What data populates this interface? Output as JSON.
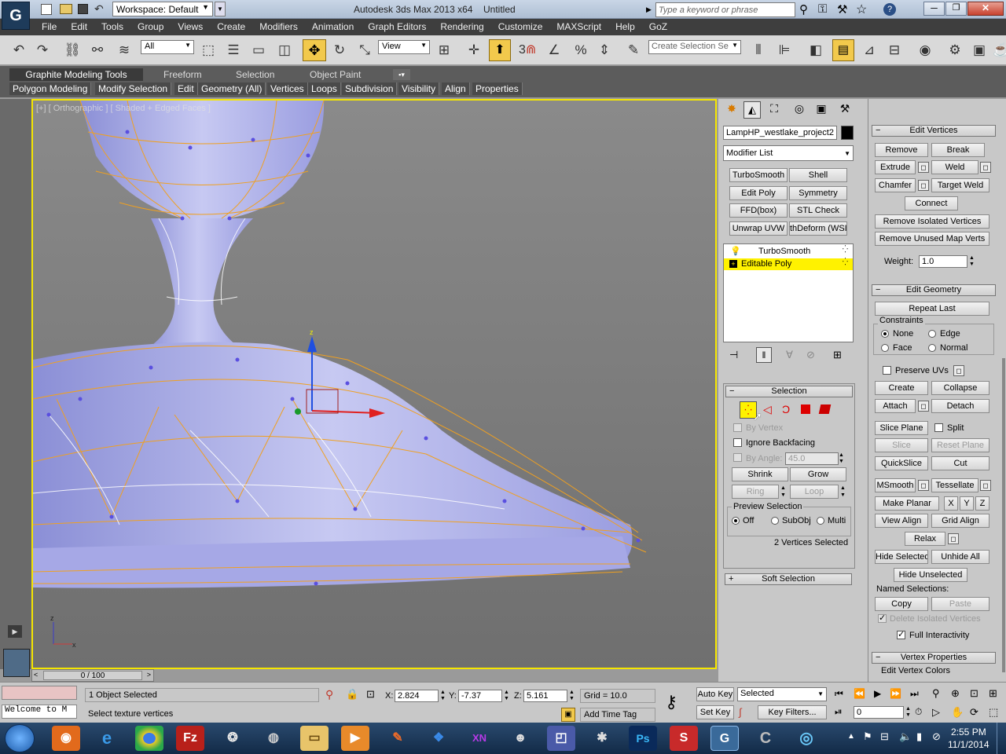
{
  "title_bar": {
    "workspace": "Workspace: Default",
    "app_title": "Autodesk 3ds Max  2013 x64",
    "doc_title": "Untitled",
    "search_placeholder": "Type a keyword or phrase"
  },
  "menu": [
    "File",
    "Edit",
    "Tools",
    "Group",
    "Views",
    "Create",
    "Modifiers",
    "Animation",
    "Graph Editors",
    "Rendering",
    "Customize",
    "MAXScript",
    "Help",
    "GoZ"
  ],
  "toolbar": {
    "filter_value": "All",
    "refcoord_value": "View",
    "named_selection_placeholder": "Create Selection Se",
    "snap_label": "3"
  },
  "ribbon": {
    "tabs": [
      "Graphite Modeling Tools",
      "Freeform",
      "Selection",
      "Object Paint"
    ],
    "subtabs": [
      "Polygon Modeling",
      "Modify Selection",
      "Edit",
      "Geometry (All)",
      "Vertices",
      "Loops",
      "Subdivision",
      "Visibility",
      "Align",
      "Properties"
    ]
  },
  "viewport": {
    "label": "[+] [ Orthographic ] [ Shaded + Edged Faces ]",
    "gizmo_z": "z",
    "axis_x": "x",
    "axis_z": "z"
  },
  "command_panel": {
    "object_name": "LampHP_westlake_project2",
    "modifier_list": "Modifier List",
    "modifier_buttons": [
      "TurboSmooth",
      "Shell",
      "Edit Poly",
      "Symmetry",
      "FFD(box)",
      "STL Check",
      "Unwrap UVW",
      "thDeform (WSI"
    ],
    "stack": [
      "TurboSmooth",
      "Editable Poly"
    ],
    "selection": {
      "header": "Selection",
      "by_vertex": "By Vertex",
      "ignore_backfacing": "Ignore Backfacing",
      "by_angle": "By Angle:",
      "angle_value": "45.0",
      "shrink": "Shrink",
      "grow": "Grow",
      "ring": "Ring",
      "loop": "Loop",
      "preview_selection": "Preview Selection",
      "off": "Off",
      "subobj": "SubObj",
      "multi": "Multi",
      "status": "2 Vertices Selected"
    },
    "soft_selection": "Soft Selection"
  },
  "right_panel": {
    "edit_vertices": "Edit Vertices",
    "remove": "Remove",
    "break": "Break",
    "extrude": "Extrude",
    "weld": "Weld",
    "chamfer": "Chamfer",
    "target_weld": "Target Weld",
    "connect": "Connect",
    "remove_isolated": "Remove Isolated Vertices",
    "remove_unused": "Remove Unused Map Verts",
    "weight_label": "Weight:",
    "weight_value": "1.0",
    "edit_geometry": "Edit Geometry",
    "repeat_last": "Repeat Last",
    "constraints": "Constraints",
    "none": "None",
    "edge": "Edge",
    "face": "Face",
    "normal": "Normal",
    "preserve_uvs": "Preserve UVs",
    "create": "Create",
    "collapse": "Collapse",
    "attach": "Attach",
    "detach": "Detach",
    "slice_plane": "Slice Plane",
    "split": "Split",
    "slice": "Slice",
    "reset_plane": "Reset Plane",
    "quickslice": "QuickSlice",
    "cut": "Cut",
    "msmooth": "MSmooth",
    "tessellate": "Tessellate",
    "make_planar": "Make Planar",
    "x": "X",
    "y": "Y",
    "z": "Z",
    "view_align": "View Align",
    "grid_align": "Grid Align",
    "relax": "Relax",
    "hide_selected": "Hide Selected",
    "unhide_all": "Unhide All",
    "hide_unselected": "Hide Unselected",
    "named_selections": "Named Selections:",
    "copy": "Copy",
    "paste": "Paste",
    "delete_isolated": "Delete Isolated Vertices",
    "full_interactivity": "Full Interactivity",
    "vertex_properties": "Vertex Properties",
    "edit_vertex_colors": "Edit Vertex Colors"
  },
  "timeline": {
    "frame": "0 / 100"
  },
  "status": {
    "welcome": "Welcome to M",
    "selected_count": "1 Object Selected",
    "prompt": "Select texture vertices",
    "x_label": "X:",
    "x_value": "2.824",
    "y_label": "Y:",
    "y_value": "-7.37",
    "z_label": "Z:",
    "z_value": "5.161",
    "grid": "Grid = 10.0",
    "add_time_tag": "Add Time Tag",
    "auto_key": "Auto Key",
    "set_key": "Set Key",
    "key_mode": "Selected",
    "key_filters": "Key Filters...",
    "frame_value": "0"
  },
  "taskbar": {
    "time": "2:55 PM",
    "date": "11/1/2014"
  }
}
